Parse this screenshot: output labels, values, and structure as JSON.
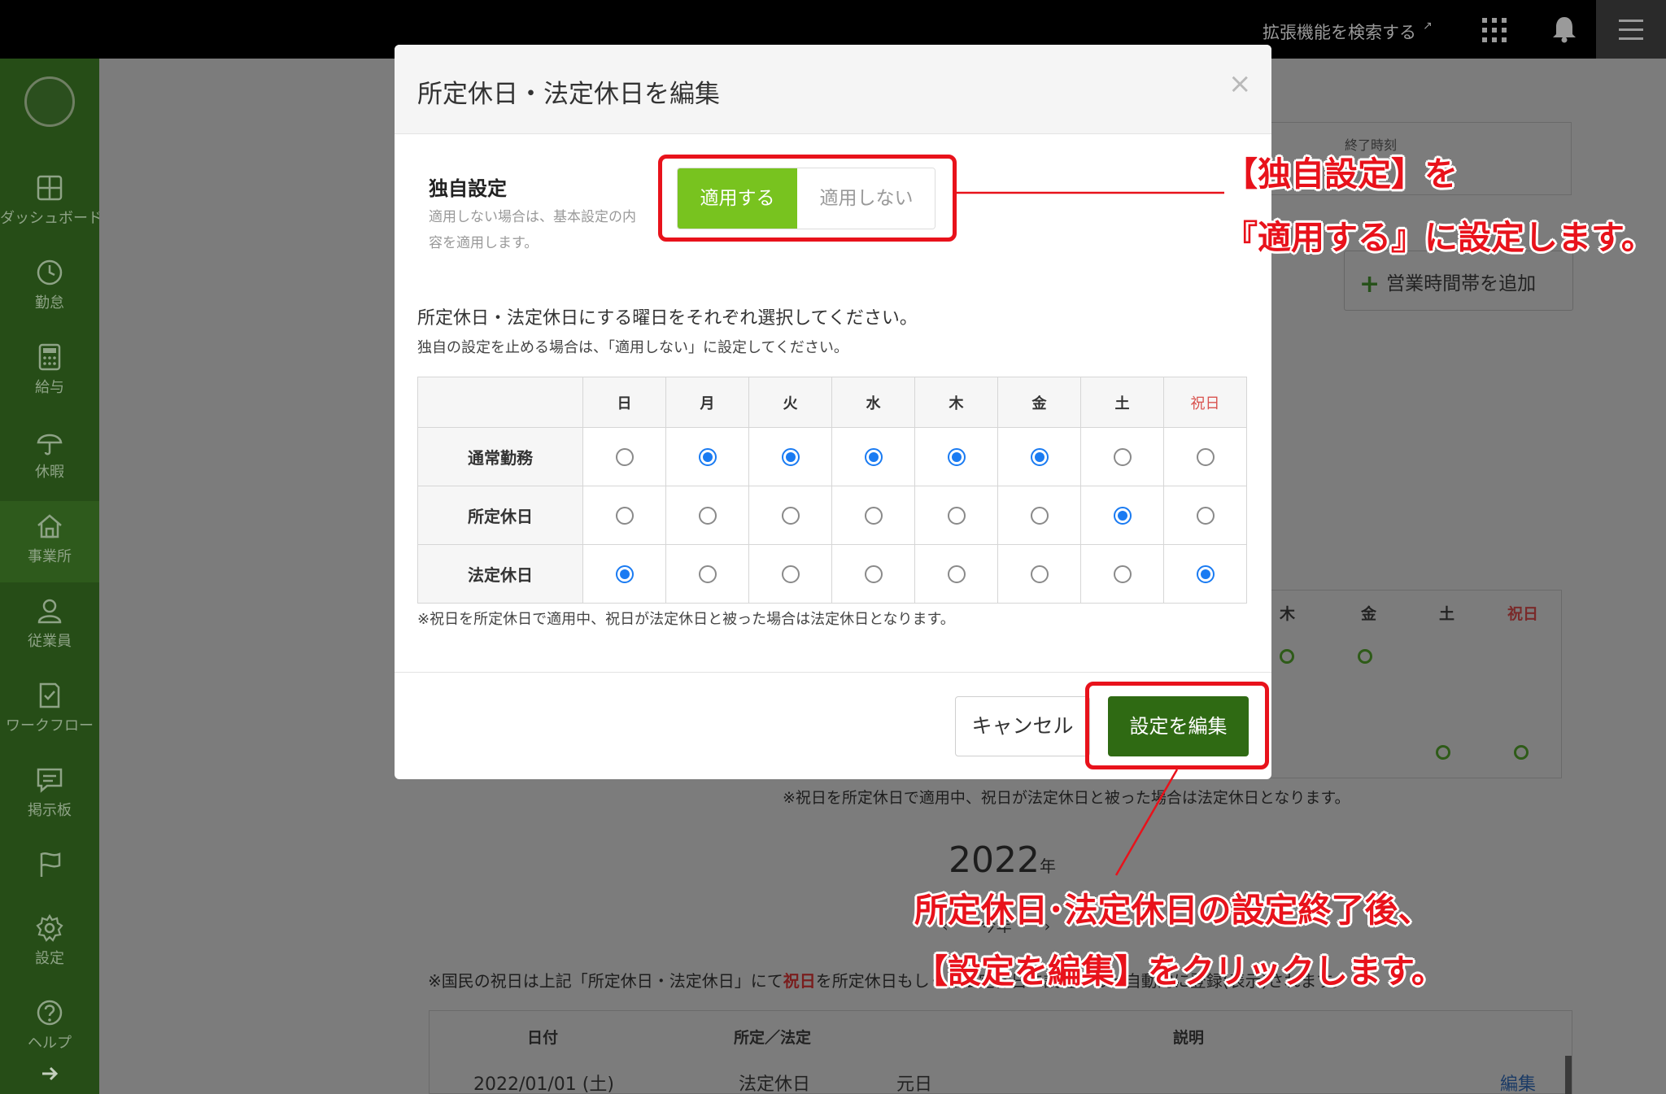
{
  "topbar": {
    "extension_search": "拡張機能を検索する",
    "extension_icon": "external-link-icon",
    "apps_icon": "apps-grid-icon",
    "bell_icon": "bell-icon",
    "menu_icon": "hamburger-menu-icon"
  },
  "sidebar": {
    "items": [
      {
        "label": "ダッシュボード",
        "icon": "dashboard-icon"
      },
      {
        "label": "勤怠",
        "icon": "clock-icon"
      },
      {
        "label": "給与",
        "icon": "calculator-icon"
      },
      {
        "label": "休暇",
        "icon": "umbrella-icon"
      },
      {
        "label": "事業所",
        "icon": "home-icon"
      },
      {
        "label": "従業員",
        "icon": "person-icon"
      },
      {
        "label": "ワークフロー",
        "icon": "workflow-icon"
      },
      {
        "label": "掲示板",
        "icon": "message-icon"
      },
      {
        "label": "",
        "icon": "flag-icon"
      },
      {
        "label": "設定",
        "icon": "gear-icon"
      },
      {
        "label": "ヘルプ",
        "icon": "help-icon"
      },
      {
        "label": "",
        "icon": "arrow-right-icon"
      }
    ]
  },
  "background": {
    "end_time_header": "終了時刻",
    "add_business_hours": "営業時間帯を追加",
    "week_headers": [
      "木",
      "金",
      "土",
      "祝日"
    ],
    "holiday_note": "※祝日を所定休日で適用中、祝日が法定休日と被った場合は法定休日となります。",
    "year": "2022",
    "year_unit": "年",
    "nav_prev": "‹",
    "nav_this_year": "今年",
    "nav_next": "›",
    "national_holiday_note_prefix": "※国民の祝日は上記「所定休日・法定休日」にて",
    "national_holiday_note_red": "祝日",
    "national_holiday_note_suffix": "を所定休日もしくは法定休日に設定すると自動的に登録(表示)されます。",
    "list_headers": [
      "日付",
      "所定／法定",
      "説明"
    ],
    "list_row": {
      "date": "2022/01/01 (土)",
      "type": "法定休日",
      "desc": "元日",
      "edit": "編集"
    }
  },
  "modal": {
    "title": "所定休日・法定休日を編集",
    "close_icon": "close-icon",
    "own_setting_label": "独自設定",
    "own_setting_desc": "適用しない場合は、基本設定の内容を適用します。",
    "toggle_on": "適用する",
    "toggle_off": "適用しない",
    "toggle_selected": "適用する",
    "instruction_1": "所定休日・法定休日にする曜日をそれぞれ選択してください。",
    "instruction_2": "独自の設定を止める場合は、「適用しない」に設定してください。",
    "days": [
      "日",
      "月",
      "火",
      "水",
      "木",
      "金",
      "土",
      "祝日"
    ],
    "rows": [
      {
        "label": "通常勤務",
        "selected": [
          false,
          true,
          true,
          true,
          true,
          true,
          false,
          false
        ]
      },
      {
        "label": "所定休日",
        "selected": [
          false,
          false,
          false,
          false,
          false,
          false,
          true,
          false
        ]
      },
      {
        "label": "法定休日",
        "selected": [
          true,
          false,
          false,
          false,
          false,
          false,
          false,
          true
        ]
      }
    ],
    "note": "※祝日を所定休日で適用中、祝日が法定休日と被った場合は法定休日となります。",
    "cancel_label": "キャンセル",
    "submit_label": "設定を編集"
  },
  "annotations": {
    "callout_1_line1": "【独自設定】を",
    "callout_1_line2": "『適用する』に設定します。",
    "callout_2_line1": "所定休日･法定休日の設定終了後、",
    "callout_2_line2": "【設定を編集】をクリックします。"
  },
  "colors": {
    "accent_green": "#78c31f",
    "submit_green": "#2f6a13",
    "radio_blue": "#1a7bf2",
    "annotation_red": "#e8121b",
    "holiday_red": "#d9534f"
  }
}
